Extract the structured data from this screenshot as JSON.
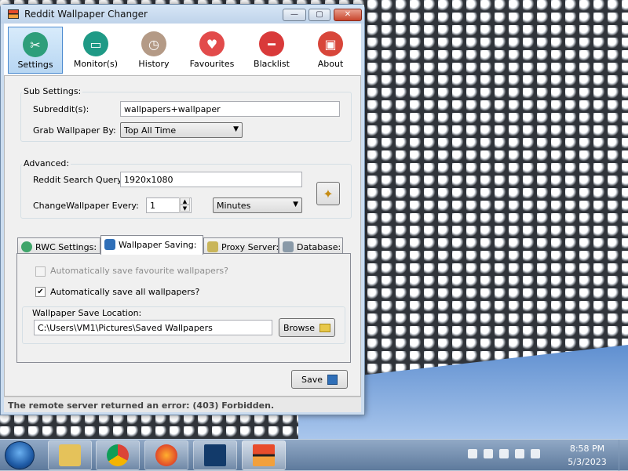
{
  "window": {
    "title": "Reddit Wallpaper Changer",
    "min": "—",
    "max": "▢",
    "close": "✕"
  },
  "toolbar": [
    {
      "label": "Settings",
      "icon": "tools-icon",
      "color": "#2e9e7a"
    },
    {
      "label": "Monitor(s)",
      "icon": "monitor-icon",
      "color": "#1f9a86"
    },
    {
      "label": "History",
      "icon": "clock-icon",
      "color": "#b49a86"
    },
    {
      "label": "Favourites",
      "icon": "heart-icon",
      "color": "#e24b4b"
    },
    {
      "label": "Blacklist",
      "icon": "no-entry-icon",
      "color": "#d93a3a"
    },
    {
      "label": "About",
      "icon": "photo-icon",
      "color": "#d8463a"
    }
  ],
  "sub_settings": {
    "heading": "Sub Settings:",
    "subreddits_label": "Subreddit(s):",
    "subreddits_value": "wallpapers+wallpaper",
    "grab_label": "Grab Wallpaper By:",
    "grab_value": "Top All Time"
  },
  "advanced": {
    "heading": "Advanced:",
    "query_label": "Reddit Search Query:",
    "query_value": "1920x1080",
    "change_label": "ChangeWallpaper Every:",
    "change_value": "1",
    "unit_value": "Minutes"
  },
  "tabs": [
    {
      "label": "RWC Settings:",
      "icon": "gear-icon"
    },
    {
      "label": "Wallpaper Saving:",
      "icon": "disk-icon"
    },
    {
      "label": "Proxy Server:",
      "icon": "server-icon"
    },
    {
      "label": "Database:",
      "icon": "database-icon"
    }
  ],
  "saving": {
    "auto_fav_label": "Automatically save favourite wallpapers?",
    "auto_all_label": "Automatically save all wallpapers?",
    "location_label": "Wallpaper Save Location:",
    "location_value": "C:\\Users\\VM1\\Pictures\\Saved Wallpapers",
    "browse_label": "Browse"
  },
  "save_label": "Save",
  "status": "The remote server returned an error: (403) Forbidden.",
  "clock": {
    "time": "8:58 PM",
    "date": "5/3/2023"
  }
}
